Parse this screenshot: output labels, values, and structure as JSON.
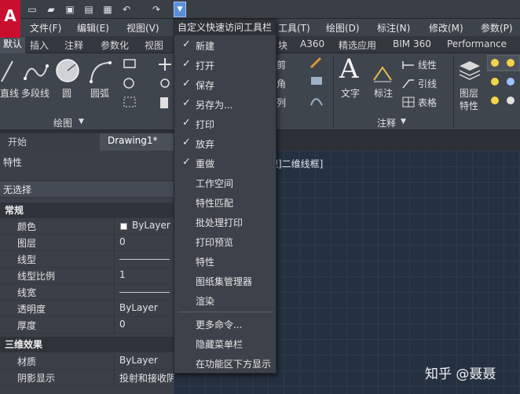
{
  "app": {
    "logo": "A"
  },
  "qat": {
    "buttons": [
      {
        "name": "new-file-icon",
        "glyph": "▭"
      },
      {
        "name": "open-folder-icon",
        "glyph": "▰"
      },
      {
        "name": "save-icon",
        "glyph": "▣"
      },
      {
        "name": "saveas-icon",
        "glyph": "▤"
      },
      {
        "name": "print-icon",
        "glyph": "▦"
      },
      {
        "name": "undo-icon",
        "glyph": "↶"
      },
      {
        "name": "redo-icon",
        "glyph": "↷"
      }
    ],
    "dropdown_glyph": "▼"
  },
  "menubar": {
    "file": "文件(F)",
    "edit": "编辑(E)",
    "view": "视图(V)",
    "tools": "工具(T)",
    "draw": "绘图(D)",
    "dimension": "标注(N)",
    "modify": "修改(M)",
    "param": "参数(P)"
  },
  "ribbon_tabs": {
    "default": "默认",
    "insert": "插入",
    "annotate": "注释",
    "parametric": "参数化",
    "view": "视图",
    "block": "块",
    "a360": "A360",
    "featured": "精选应用",
    "bim360": "BIM 360",
    "performance": "Performance"
  },
  "ribbon": {
    "line": "直线",
    "polyline": "多段线",
    "circle": "圆",
    "arc": "圆弧",
    "draw_panel": "绘图",
    "trim": "剪",
    "fillet": "角",
    "array": "列",
    "text": "文字",
    "text_glyph": "A",
    "dim": "标注",
    "linear": "线性",
    "leader": "引线",
    "table": "表格",
    "annotate_panel": "注释",
    "layer_props": "图层",
    "layer_props2": "特性"
  },
  "doctabs": {
    "start": "开始",
    "drawing": "Drawing1*"
  },
  "properties": {
    "title": "特性",
    "selection": "无选择",
    "sections": {
      "general": "常规",
      "3d": "三维效果"
    },
    "rows": [
      {
        "name": "颜色",
        "value": "ByLayer",
        "swatch": true
      },
      {
        "name": "图层",
        "value": "0"
      },
      {
        "name": "线型",
        "value": "",
        "line": true
      },
      {
        "name": "线型比例",
        "value": "1"
      },
      {
        "name": "线宽",
        "value": "",
        "line": true
      },
      {
        "name": "透明度",
        "value": "ByLayer"
      },
      {
        "name": "厚度",
        "value": "0"
      }
    ],
    "rows3d": [
      {
        "name": "材质",
        "value": "ByLayer"
      },
      {
        "name": "阴影显示",
        "value": "投射和接收阴影"
      }
    ]
  },
  "viewport": {
    "label": "视]二维线框]"
  },
  "menu": {
    "title": "自定义快速访问工具栏",
    "items": [
      {
        "label": "新建",
        "checked": true
      },
      {
        "label": "打开",
        "checked": true
      },
      {
        "label": "保存",
        "checked": true
      },
      {
        "label": "另存为...",
        "checked": true
      },
      {
        "label": "打印",
        "checked": true
      },
      {
        "label": "放弃",
        "checked": true
      },
      {
        "label": "重做",
        "checked": true
      },
      {
        "label": "工作空间",
        "checked": false
      },
      {
        "label": "特性匹配",
        "checked": false
      },
      {
        "label": "批处理打印",
        "checked": false
      },
      {
        "label": "打印预览",
        "checked": false
      },
      {
        "label": "特性",
        "checked": false
      },
      {
        "label": "图纸集管理器",
        "checked": false
      },
      {
        "label": "渲染",
        "checked": false
      }
    ],
    "extra": [
      {
        "label": "更多命令..."
      },
      {
        "label": "隐藏菜单栏"
      },
      {
        "label": "在功能区下方显示"
      }
    ],
    "check_glyph": "✓"
  },
  "watermark": "知乎 @聂聂"
}
